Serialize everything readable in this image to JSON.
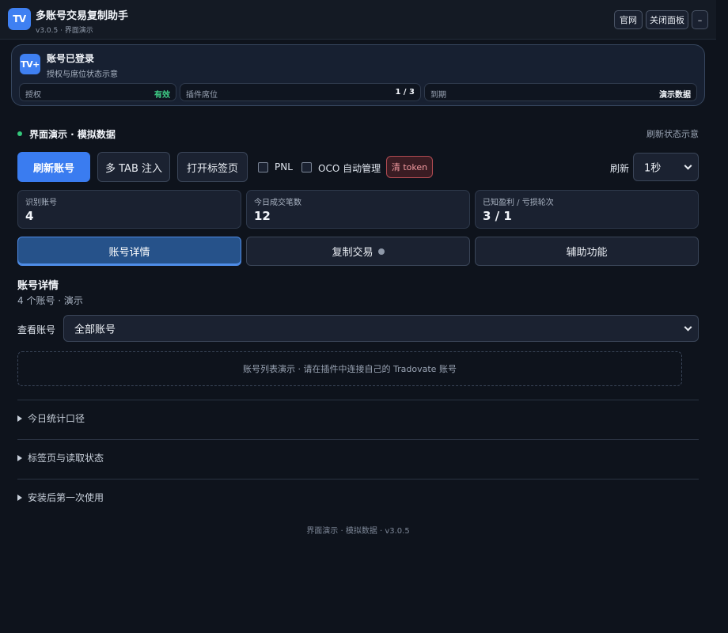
{
  "header": {
    "logo_text": "TV",
    "title": "多账号交易复制助手",
    "version": "v3.0.5 · 界面演示",
    "btn_site": "官网",
    "btn_close_panel": "关闭面板",
    "btn_minimize": "–"
  },
  "license": {
    "logo_text": "TV+",
    "title": "账号已登录",
    "subtitle": "授权与席位状态示意",
    "auth_label": "授权",
    "auth_value": "有效",
    "seat_label": "插件席位",
    "seat_value": "1 / 3",
    "expire_label": "到期",
    "expire_value": "演示数据"
  },
  "status": {
    "label": "界面演示 · 模拟数据",
    "right": "刷新状态示意"
  },
  "toolbar": {
    "refresh_accounts": "刷新账号",
    "multi_tab_inject": "多 TAB 注入",
    "open_tabs": "打开标签页",
    "pnl_label": "PNL",
    "oco_label": "OCO 自动管理",
    "clear_token": "清 token",
    "refresh_label": "刷新",
    "refresh_interval": "1秒"
  },
  "stats": [
    {
      "label": "识别账号",
      "value": "4"
    },
    {
      "label": "今日成交笔数",
      "value": "12"
    },
    {
      "label": "已知盈利 / 亏损轮次",
      "value": "3 / 1"
    }
  ],
  "tabs": {
    "account_details": "账号详情",
    "copy_trading": "复制交易",
    "helper": "辅助功能"
  },
  "details": {
    "title": "账号详情",
    "subtitle": "4 个账号 · 演示",
    "view_label": "查看账号",
    "view_value": "全部账号",
    "empty_text": "账号列表演示 · 请在插件中连接自己的 Tradovate 账号"
  },
  "sections": {
    "stats_scope": "今日统计口径",
    "tab_status": "标签页与读取状态",
    "first_use": "安装后第一次使用"
  },
  "footer": "界面演示 · 模拟数据 · v3.0.5"
}
